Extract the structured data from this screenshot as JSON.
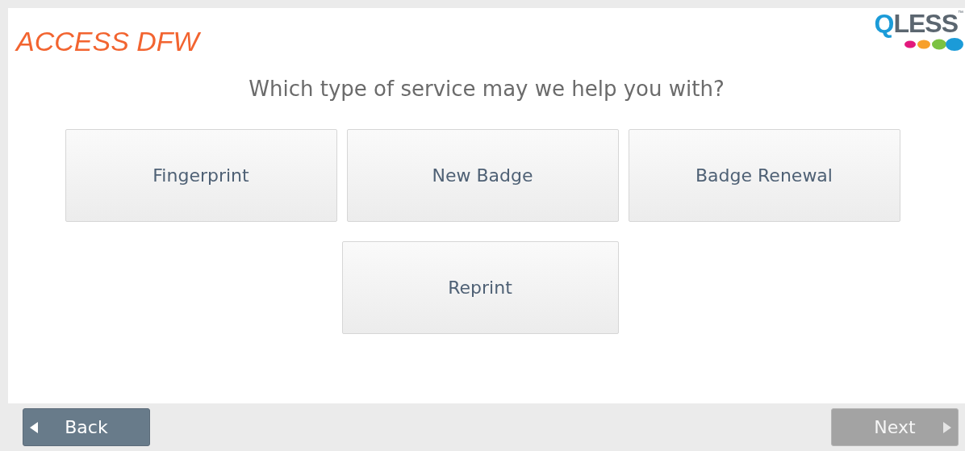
{
  "header": {
    "title": "ACCESS DFW",
    "logo": {
      "text": "QLESS",
      "mark": "™"
    }
  },
  "prompt": "Which type of service may we help you with?",
  "services": [
    {
      "label": "Fingerprint"
    },
    {
      "label": "New Badge"
    },
    {
      "label": "Badge Renewal"
    },
    {
      "label": "Reprint"
    }
  ],
  "footer": {
    "back": {
      "label": "Back",
      "disabled": false
    },
    "next": {
      "label": "Next",
      "disabled": true
    }
  }
}
